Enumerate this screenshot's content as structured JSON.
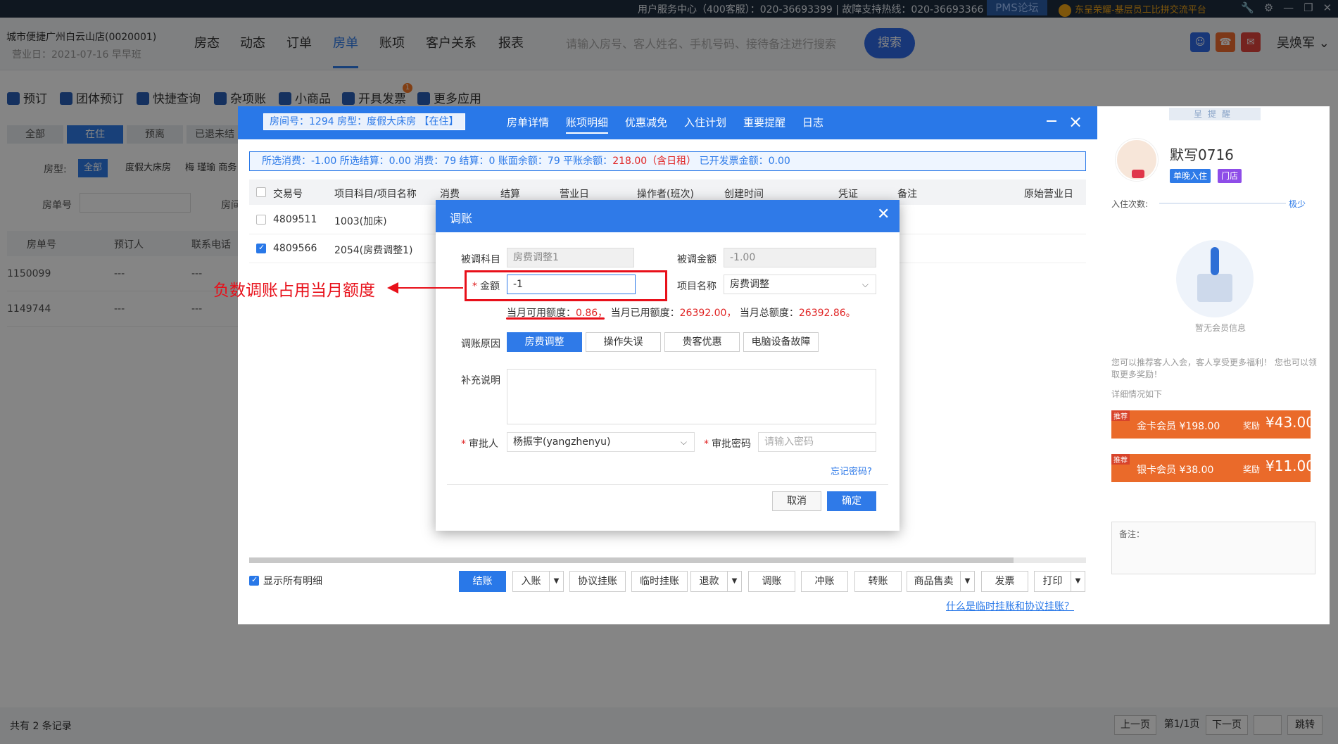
{
  "sysbar": {
    "service": "用户服务中心（400客服）：020-36693399 | 故障支持热线：020-36693366",
    "pms_label": "PMS论坛",
    "brand": "东呈荣耀-基层员工比拼交流平台"
  },
  "header": {
    "store": "城市便捷广州白云山店(0020001)",
    "biz_date": "营业日：2021-07-16   早早班",
    "tabs": [
      "房态",
      "动态",
      "订单",
      "房单",
      "账项",
      "客户关系",
      "报表"
    ],
    "active_tab": "房单",
    "search_placeholder": "请输入房号、客人姓名、手机号码、接待备注进行搜索",
    "search_button": "搜索",
    "user": "吴焕军"
  },
  "toolbar": [
    "预订",
    "团体预订",
    "快捷查询",
    "杂项账",
    "小商品",
    "开具发票",
    "更多应用"
  ],
  "toolbar_badge": "1",
  "left_panel": {
    "filters": [
      "全部",
      "在住",
      "预离",
      "已退未结"
    ],
    "room_type_label": "房型:",
    "room_types": [
      "全部",
      "度假大床房",
      "梅 瑾瑜 商务"
    ],
    "order_no_label": "房单号",
    "order_no_label2": "房间",
    "columns": [
      "房单号",
      "预订人",
      "联系电话"
    ],
    "rows": [
      [
        "1150099",
        "---",
        "---"
      ],
      [
        "1149744",
        "---",
        "---"
      ]
    ]
  },
  "order": {
    "room_info": "房间号：1294 房型：度假大床房 【在住】",
    "tabs": [
      "房单详情",
      "账项明细",
      "优惠减免",
      "入住计划",
      "重要提醒",
      "日志"
    ],
    "active_tab": "账项明细",
    "summary_pre": "所选消费：-1.00   所选结算：0.00   消费：79   结算：0   账面余额：79   平账余额：",
    "summary_red": "218.00（含日租）",
    "summary_post": "   已开发票金额：0.00",
    "columns": [
      "交易号",
      "项目科目/项目名称",
      "消费",
      "结算",
      "营业日",
      "操作者(班次)",
      "创建时间",
      "凭证",
      "备注",
      "原始营业日"
    ],
    "rows": [
      {
        "id": "4809511",
        "name": "1003(加床)",
        "checked": false
      },
      {
        "id": "4809566",
        "name": "2054(房费调整1)",
        "checked": true
      }
    ],
    "show_all": "显示所有明细",
    "actions": [
      "结账",
      "入账",
      "协议挂账",
      "临时挂账",
      "退款",
      "调账",
      "冲账",
      "转账",
      "商品售卖",
      "发票",
      "打印"
    ],
    "help_link": "什么是临时挂账和协议挂账？"
  },
  "modal": {
    "title": "调账",
    "adjusted_item_label": "被调科目",
    "adjusted_item_value": "房费调整1",
    "adjusted_amount_label": "被调金额",
    "adjusted_amount_value": "-1.00",
    "amount_label": "金额",
    "amount_value": "-1",
    "item_name_label": "项目名称",
    "item_name_value": "房费调整",
    "quota_available_label": "当月可用额度：",
    "quota_available_value": "0.86，",
    "quota_used_label": "当月已用额度：",
    "quota_used_value": "26392.00，",
    "quota_total_label": "当月总额度：",
    "quota_total_value": "26392.86。",
    "reason_label": "调账原因",
    "reasons": [
      "房费调整",
      "操作失误",
      "贵客优惠",
      "电脑设备故障"
    ],
    "active_reason": "房费调整",
    "note_label": "补充说明",
    "approver_label": "审批人",
    "approver_value": "杨振宇(yangzhenyu)",
    "password_label": "审批密码",
    "password_placeholder": "请输入密码",
    "forgot": "忘记密码?",
    "cancel": "取消",
    "confirm": "确定"
  },
  "annotation": "负数调账占用当月额度",
  "member": {
    "header_tab": "呈提醒",
    "name": "默写0716",
    "tags": [
      "单晚入住",
      "门店"
    ],
    "stay_count_label": "入住次数:",
    "level": "极少",
    "empty": "暂无会员信息",
    "invite": "您可以推荐客人入会，客人享受更多福利！ 您也可以领取更多奖励！",
    "detail": "详细情况如下",
    "cards": [
      {
        "rec": "推荐",
        "name": "金卡会员 ¥198.00",
        "reward": "奖励",
        "amount": "¥43.00"
      },
      {
        "rec": "推荐",
        "name": "银卡会员 ¥38.00",
        "reward": "奖励",
        "amount": "¥11.00"
      }
    ],
    "note_label": "备注："
  },
  "footer": {
    "total": "共有 2 条记录",
    "prev": "上一页",
    "page": "第1/1页",
    "next": "下一页",
    "jump": "跳转"
  },
  "colors": {
    "accent": "#2978e8",
    "annotation": "#e8101a",
    "warn": "#e02424"
  }
}
